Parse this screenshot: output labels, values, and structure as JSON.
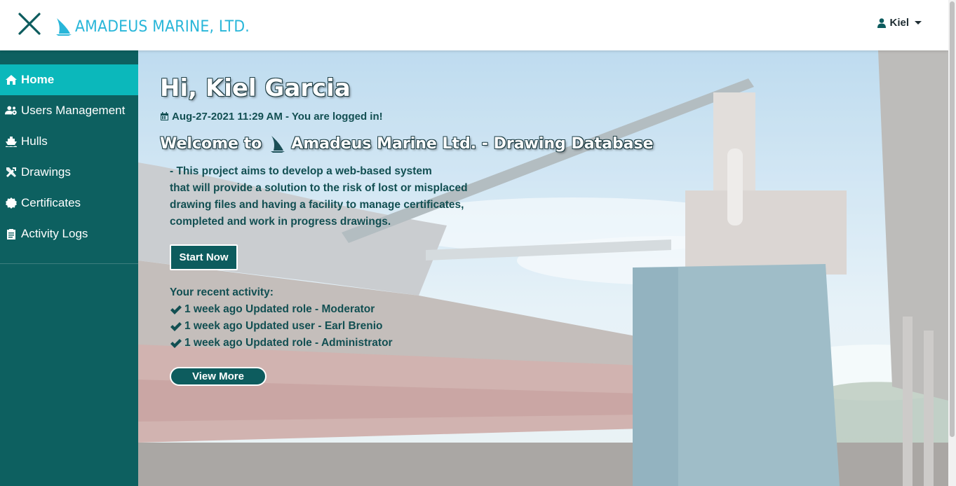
{
  "header": {
    "brand": "AMADEUS MARINE, LTD.",
    "user_name": "Kiel"
  },
  "sidebar": {
    "items": [
      {
        "label": "Home",
        "icon": "home-icon",
        "active": true
      },
      {
        "label": "Users Management",
        "icon": "users-cog-icon",
        "active": false
      },
      {
        "label": "Hulls",
        "icon": "ship-icon",
        "active": false
      },
      {
        "label": "Drawings",
        "icon": "tools-icon",
        "active": false
      },
      {
        "label": "Certificates",
        "icon": "certificate-icon",
        "active": false
      },
      {
        "label": "Activity Logs",
        "icon": "clipboard-icon",
        "active": false
      }
    ]
  },
  "main": {
    "greeting": "Hi, Kiel Garcia",
    "logged_status": "Aug-27-2021 11:29 AM - You are logged in!",
    "welcome_prefix": "Welcome to",
    "welcome_title": "Amadeus Marine Ltd. - Drawing Database",
    "description_lines": [
      "- This project aims to develop a web-based system",
      "that will provide a solution to the risk of lost or misplaced",
      "drawing files and having a facility to manage certificates,",
      "completed and work in progress drawings."
    ],
    "start_button": "Start Now",
    "recent_title": "Your recent activity:",
    "activities": [
      "1 week ago Updated role - Moderator",
      "1 week ago Updated user - Earl Brenio",
      "1 week ago Updated role - Administrator"
    ],
    "view_more_button": "View More"
  },
  "colors": {
    "sidebar_bg": "#0d6060",
    "sidebar_active": "#0bb8bb",
    "brand": "#28b6d9",
    "button_bg": "#0d5c5e",
    "text_dark_teal": "#124f52"
  }
}
